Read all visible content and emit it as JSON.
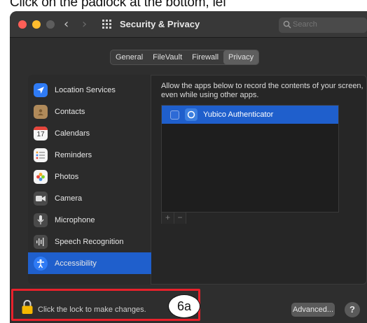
{
  "caption": "Click on the padlock at the bottom, lef",
  "window": {
    "title": "Security & Privacy",
    "search_placeholder": "Search"
  },
  "tabs": [
    {
      "label": "General",
      "active": false
    },
    {
      "label": "FileVault",
      "active": false
    },
    {
      "label": "Firewall",
      "active": false
    },
    {
      "label": "Privacy",
      "active": true
    }
  ],
  "sidebar": {
    "items": [
      {
        "label": "Location Services",
        "icon": "location-arrow-icon",
        "color": "#2f7bf5"
      },
      {
        "label": "Contacts",
        "icon": "contacts-book-icon",
        "color": "#b08a5a"
      },
      {
        "label": "Calendars",
        "icon": "calendar-icon",
        "color": "#f5f5f5",
        "badge": "17"
      },
      {
        "label": "Reminders",
        "icon": "reminders-list-icon",
        "color": "#f5f5f5"
      },
      {
        "label": "Photos",
        "icon": "photos-flower-icon",
        "color": "#f5f5f5"
      },
      {
        "label": "Camera",
        "icon": "camera-icon",
        "color": "#4a4a4a"
      },
      {
        "label": "Microphone",
        "icon": "microphone-icon",
        "color": "#4a4a4a"
      },
      {
        "label": "Speech Recognition",
        "icon": "waveform-icon",
        "color": "#4a4a4a"
      },
      {
        "label": "Accessibility",
        "icon": "accessibility-icon",
        "color": "#2f7bf5"
      }
    ]
  },
  "main": {
    "description": "Allow the apps below to record the contents of your screen, even while using other apps.",
    "apps": [
      {
        "name": "Yubico Authenticator",
        "checked": false
      }
    ],
    "add_label": "+",
    "remove_label": "−"
  },
  "footer": {
    "lock_text": "Click the lock to make changes.",
    "advanced_label": "Advanced...",
    "help_label": "?"
  },
  "annotation": {
    "step_label": "6a",
    "color": "#e8212b"
  }
}
